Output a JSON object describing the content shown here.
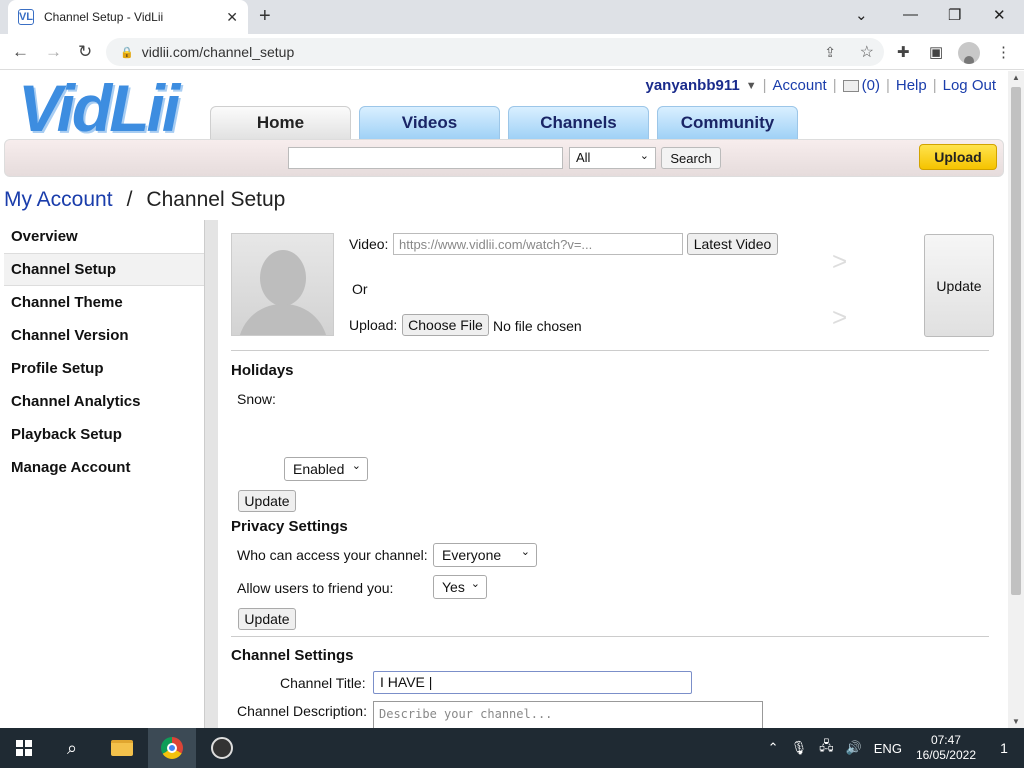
{
  "browser": {
    "tab_title": "Channel Setup - VidLii",
    "favicon": "VL",
    "url": "vidlii.com/channel_setup",
    "new_tab": "+",
    "close_tab": "✕"
  },
  "header": {
    "logo": "VidLii",
    "username": "yanyanbb911",
    "links": {
      "account": "Account",
      "inbox_count": "(0)",
      "help": "Help",
      "logout": "Log Out"
    },
    "nav_tabs": [
      {
        "label": "Home",
        "active": true
      },
      {
        "label": "Videos",
        "active": false
      },
      {
        "label": "Channels",
        "active": false
      },
      {
        "label": "Community",
        "active": false
      }
    ],
    "search": {
      "value": "",
      "category": "All",
      "button": "Search"
    },
    "upload_button": "Upload"
  },
  "breadcrumb": {
    "parent": "My Account",
    "separator": "/",
    "current": "Channel Setup"
  },
  "sidebar": {
    "items": [
      {
        "label": "Overview",
        "active": false
      },
      {
        "label": "Channel Setup",
        "active": true
      },
      {
        "label": "Channel Theme",
        "active": false
      },
      {
        "label": "Channel Version",
        "active": false
      },
      {
        "label": "Profile Setup",
        "active": false
      },
      {
        "label": "Channel Analytics",
        "active": false
      },
      {
        "label": "Playback Setup",
        "active": false
      },
      {
        "label": "Manage Account",
        "active": false
      }
    ]
  },
  "avatar_section": {
    "video_label": "Video:",
    "video_placeholder": "https://www.vidlii.com/watch?v=...",
    "latest_video_button": "Latest Video",
    "or_label": "Or",
    "upload_label": "Upload:",
    "choose_file_button": "Choose File",
    "no_file_text": "No file chosen",
    "arrow": ">",
    "update_button": "Update"
  },
  "holidays": {
    "title": "Holidays",
    "snow_label": "Snow:",
    "snow_value": "Enabled",
    "update_button": "Update"
  },
  "privacy": {
    "title": "Privacy Settings",
    "access_label": "Who can access your channel:",
    "access_value": "Everyone",
    "friend_label": "Allow users to friend you:",
    "friend_value": "Yes",
    "update_button": "Update"
  },
  "channel_settings": {
    "title": "Channel Settings",
    "title_label": "Channel Title:",
    "title_value": "I HAVE |",
    "description_label": "Channel Description:",
    "description_placeholder": "Describe your channel..."
  },
  "taskbar": {
    "language": "ENG",
    "time": "07:47",
    "date": "16/05/2022",
    "notifications": "1"
  },
  "colors": {
    "link": "#1a3dab",
    "nav_tab": "#9fd1f6",
    "upload_yellow": "#f5c300",
    "taskbar": "#1f2a33"
  }
}
